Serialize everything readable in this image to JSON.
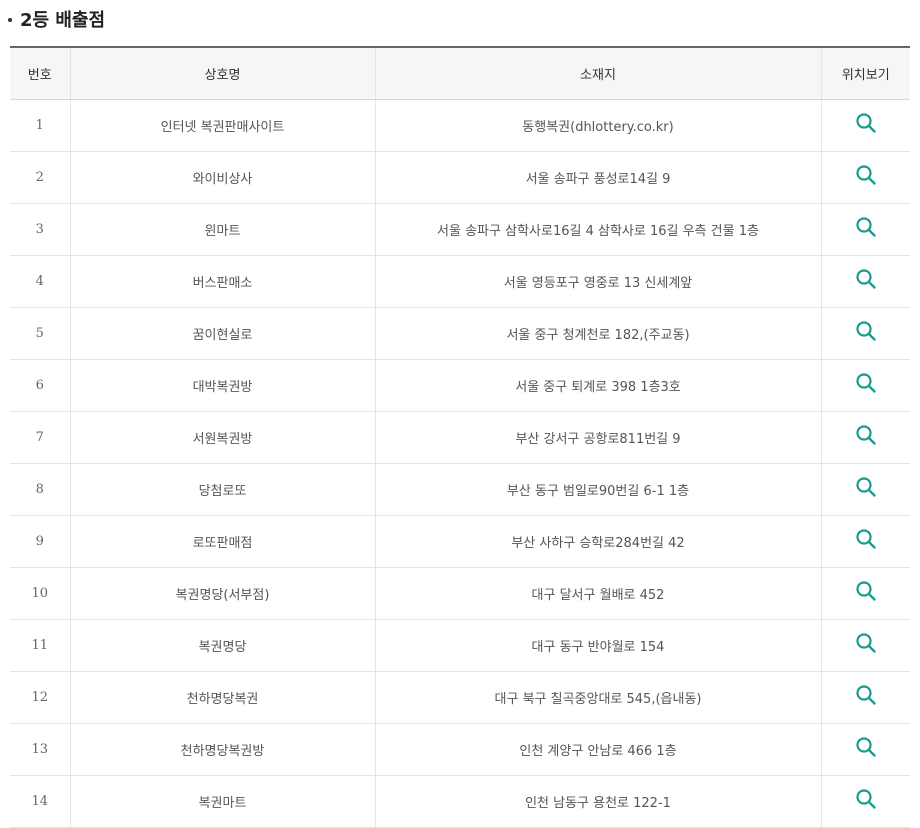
{
  "page": {
    "title": "2등 배출점"
  },
  "colors": {
    "accent": "#1a9a8e"
  },
  "table": {
    "headers": [
      "번호",
      "상호명",
      "소재지",
      "위치보기"
    ],
    "rows": [
      {
        "no": "1",
        "name": "인터넷 복권판매사이트",
        "address": "동행복권(dhlottery.co.kr)",
        "icon": "search-icon"
      },
      {
        "no": "2",
        "name": "와이비상사",
        "address": "서울 송파구 풍성로14길 9",
        "icon": "search-icon"
      },
      {
        "no": "3",
        "name": "윈마트",
        "address": "서울 송파구 삼학사로16길 4 삼학사로 16길 우측 건물 1층",
        "icon": "search-icon"
      },
      {
        "no": "4",
        "name": "버스판매소",
        "address": "서울 영등포구 영중로 13 신세계앞",
        "icon": "search-icon"
      },
      {
        "no": "5",
        "name": "꿈이현실로",
        "address": "서울 중구 청계천로 182,(주교동)",
        "icon": "search-icon"
      },
      {
        "no": "6",
        "name": "대박복권방",
        "address": "서울 중구 퇴계로 398 1층3호",
        "icon": "search-icon"
      },
      {
        "no": "7",
        "name": "서원복권방",
        "address": "부산 강서구 공항로811번길 9",
        "icon": "search-icon"
      },
      {
        "no": "8",
        "name": "당첨로또",
        "address": "부산 동구 범일로90번길 6-1 1층",
        "icon": "search-icon"
      },
      {
        "no": "9",
        "name": "로또판매점",
        "address": "부산 사하구 승학로284번길 42",
        "icon": "search-icon"
      },
      {
        "no": "10",
        "name": "복권명당(서부점)",
        "address": "대구 달서구 월배로 452",
        "icon": "search-icon"
      },
      {
        "no": "11",
        "name": "복권명당",
        "address": "대구 동구 반야월로 154",
        "icon": "search-icon"
      },
      {
        "no": "12",
        "name": "천하명당복권",
        "address": "대구 북구 칠곡중앙대로 545,(읍내동)",
        "icon": "search-icon"
      },
      {
        "no": "13",
        "name": "천하명당복권방",
        "address": "인천 계양구 안남로 466 1층",
        "icon": "search-icon"
      },
      {
        "no": "14",
        "name": "복권마트",
        "address": "인천 남동구 용천로 122-1",
        "icon": "search-icon"
      }
    ]
  }
}
